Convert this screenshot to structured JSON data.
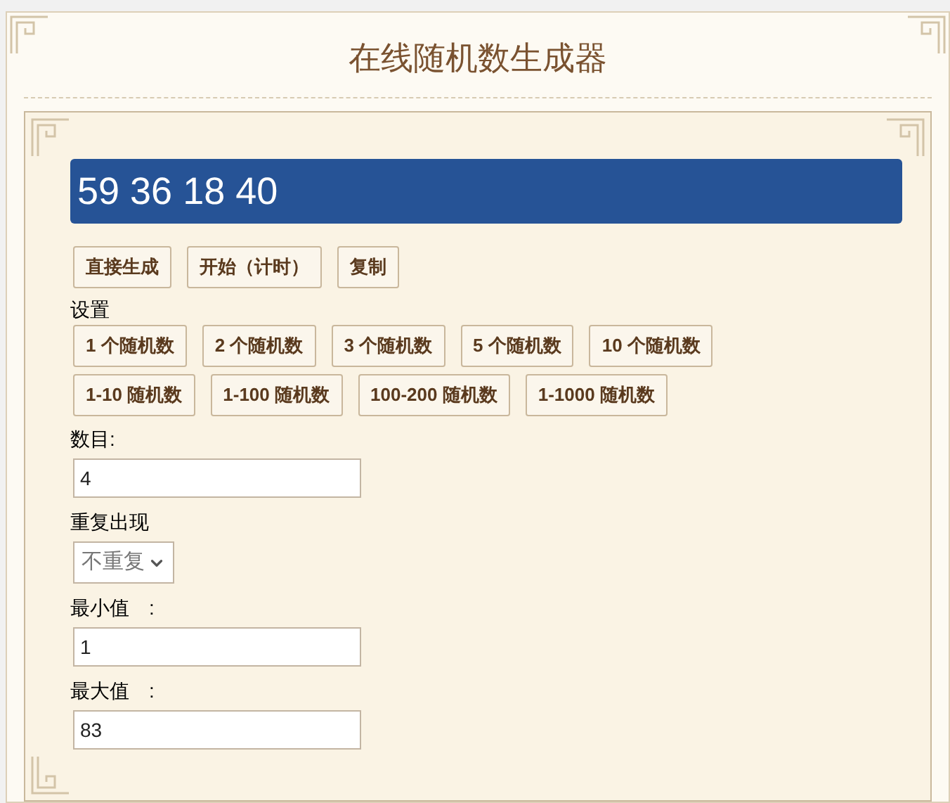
{
  "title": "在线随机数生成器",
  "result": "59 36 18 40",
  "actions": [
    "直接生成",
    "开始（计时）",
    "复制"
  ],
  "settings_label": "设置",
  "presets": [
    [
      "1 个随机数",
      "2 个随机数",
      "3 个随机数",
      "5 个随机数",
      "10 个随机数"
    ],
    [
      "1-10 随机数",
      "1-100 随机数",
      "100-200 随机数",
      "1-1000 随机数"
    ]
  ],
  "fields": [
    {
      "kind": "input",
      "label": "数目:",
      "value": "4"
    },
    {
      "kind": "select",
      "label": "重复出现",
      "value": "不重复"
    },
    {
      "kind": "input",
      "label": "最小值　:",
      "value": "1"
    },
    {
      "kind": "input",
      "label": "最大值　:",
      "value": "83"
    }
  ]
}
